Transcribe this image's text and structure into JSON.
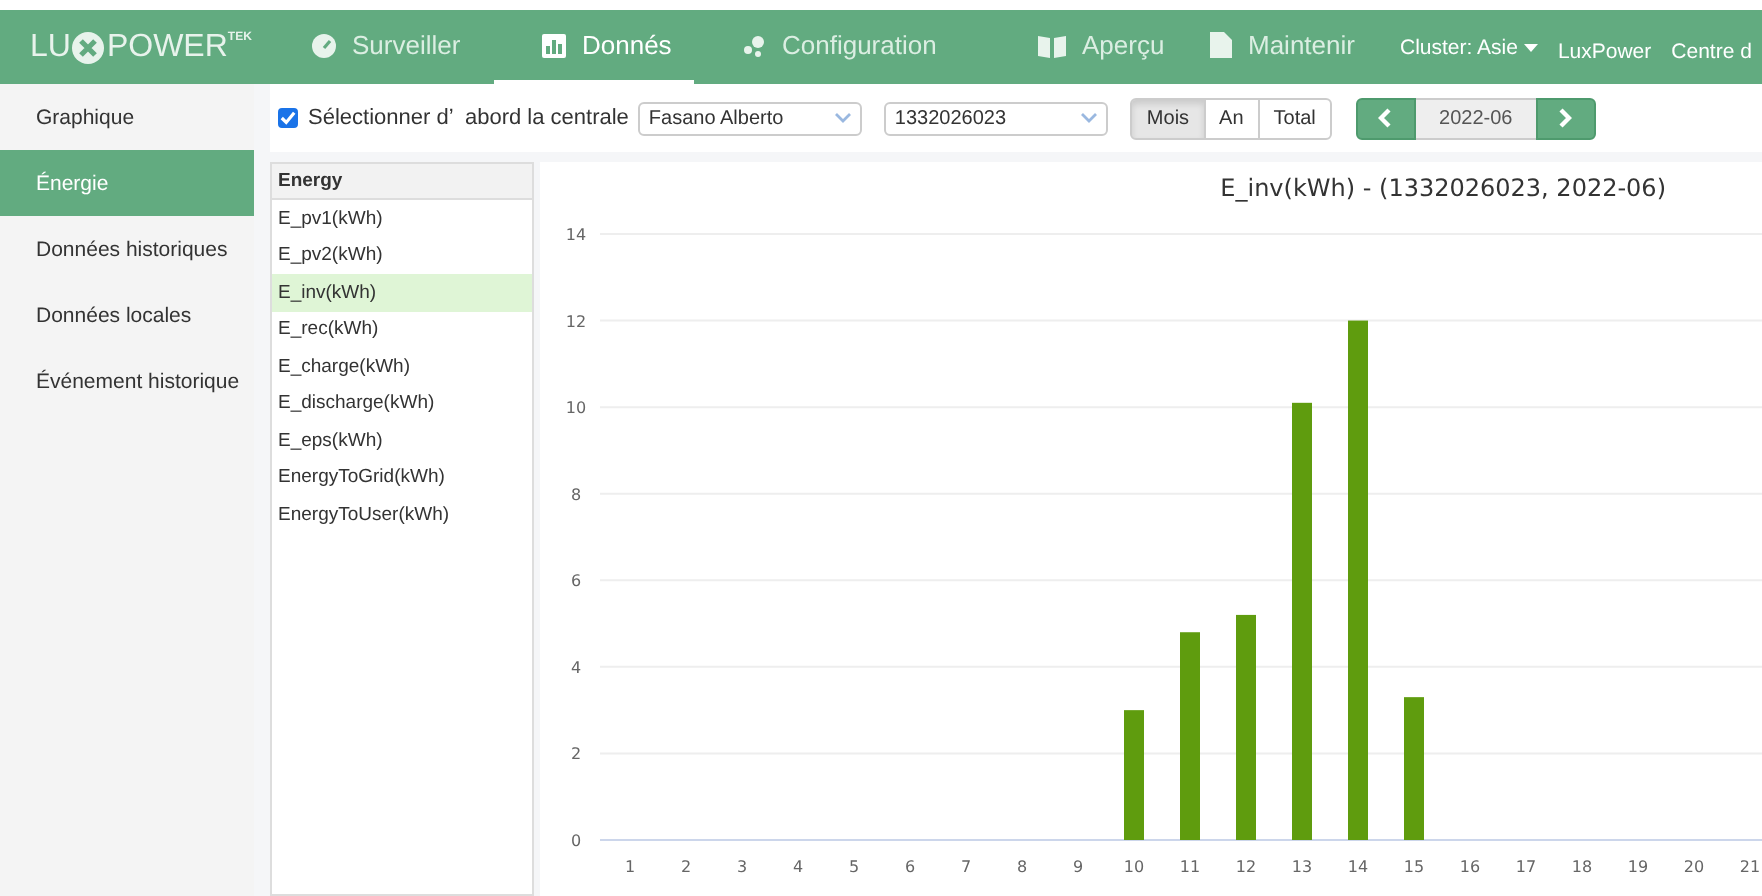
{
  "logo": {
    "left": "LU",
    "right": "POWER",
    "sup": "TEK"
  },
  "nav": [
    {
      "label": "Surveiller",
      "selected": false
    },
    {
      "label": "Donnés",
      "selected": true
    },
    {
      "label": "Configuration",
      "selected": false
    },
    {
      "label": "Aperçu",
      "selected": false
    },
    {
      "label": "Maintenir",
      "selected": false
    }
  ],
  "nav_right": [
    {
      "label": "Cluster: Asie",
      "kind": "dropdown"
    },
    {
      "label": "LuxPower",
      "kind": "link"
    },
    {
      "label": "Centre d",
      "kind": "link"
    }
  ],
  "sidebar": {
    "items": [
      {
        "label": "Graphique",
        "selected": false
      },
      {
        "label": "Énergie",
        "selected": true
      },
      {
        "label": "Données historiques",
        "selected": false
      },
      {
        "label": "Données locales",
        "selected": false
      },
      {
        "label": "Événement historique",
        "selected": false
      }
    ]
  },
  "toolbar": {
    "checkbox": {
      "label": "Sélectionner d’  abord la centrale",
      "checked": true
    },
    "plant": "Fasano Alberto",
    "device": "1332026023",
    "periods": [
      {
        "label": "Mois",
        "selected": true
      },
      {
        "label": "An",
        "selected": false
      },
      {
        "label": "Total",
        "selected": false
      }
    ],
    "date": "2022-06"
  },
  "energy_list": {
    "header": "Energy",
    "items": [
      {
        "label": "E_pv1(kWh)",
        "selected": false
      },
      {
        "label": "E_pv2(kWh)",
        "selected": false
      },
      {
        "label": "E_inv(kWh)",
        "selected": true
      },
      {
        "label": "E_rec(kWh)",
        "selected": false
      },
      {
        "label": "E_charge(kWh)",
        "selected": false
      },
      {
        "label": "E_discharge(kWh)",
        "selected": false
      },
      {
        "label": "E_eps(kWh)",
        "selected": false
      },
      {
        "label": "EnergyToGrid(kWh)",
        "selected": false
      },
      {
        "label": "EnergyToUser(kWh)",
        "selected": false
      }
    ]
  },
  "chart": {
    "chart_data": {
      "type": "bar",
      "title": "E_inv(kWh) - (1332026023, 2022-06)",
      "categories": [
        "1",
        "2",
        "3",
        "4",
        "5",
        "6",
        "7",
        "8",
        "9",
        "10",
        "11",
        "12",
        "13",
        "14",
        "15",
        "16",
        "17",
        "18",
        "19",
        "20",
        "21"
      ],
      "grid": true,
      "series": [
        {
          "color": "#5f9c0e",
          "values": [
            0,
            0,
            0,
            0,
            0,
            0,
            0,
            0,
            0,
            3.0,
            4.8,
            5.2,
            10.1,
            12.0,
            3.3,
            0,
            0,
            0,
            0,
            0,
            0
          ]
        }
      ],
      "ylim": [
        0,
        14
      ],
      "yticks": [
        0,
        2,
        4,
        6,
        8,
        10,
        12,
        14
      ]
    }
  }
}
